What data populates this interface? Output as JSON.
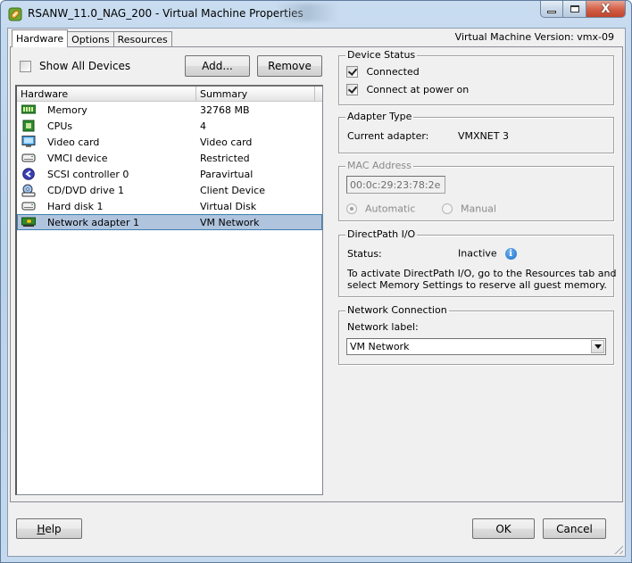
{
  "window": {
    "title": "RSANW_11.0_NAG_200 - Virtual Machine Properties",
    "app_icon": "vsphere-icon",
    "caption_buttons": {
      "minimize": "minimize-icon",
      "maximize": "maximize-icon",
      "close": "close-icon",
      "close_glyph": "X"
    }
  },
  "tabs": [
    {
      "label": "Hardware",
      "active": true
    },
    {
      "label": "Options",
      "active": false
    },
    {
      "label": "Resources",
      "active": false
    }
  ],
  "vm_version": "Virtual Machine Version: vmx-09",
  "hardware_panel": {
    "show_all_devices": {
      "label": "Show All Devices",
      "checked": false
    },
    "add_button": "Add...",
    "remove_button": "Remove",
    "table": {
      "columns": [
        "Hardware",
        "Summary"
      ],
      "rows": [
        {
          "icon": "memory-icon",
          "name": "Memory",
          "summary": "32768 MB",
          "selected": false
        },
        {
          "icon": "cpu-icon",
          "name": "CPUs",
          "summary": "4",
          "selected": false
        },
        {
          "icon": "monitor-icon",
          "name": "Video card",
          "summary": "Video card",
          "selected": false
        },
        {
          "icon": "device-icon",
          "name": "VMCI device",
          "summary": "Restricted",
          "selected": false
        },
        {
          "icon": "scsi-icon",
          "name": "SCSI controller 0",
          "summary": "Paravirtual",
          "selected": false
        },
        {
          "icon": "cd-dvd-icon",
          "name": "CD/DVD drive 1",
          "summary": "Client Device",
          "selected": false
        },
        {
          "icon": "hard-disk-icon",
          "name": "Hard disk 1",
          "summary": "Virtual Disk",
          "selected": false
        },
        {
          "icon": "network-adapter-icon",
          "name": "Network adapter 1",
          "summary": "VM Network",
          "selected": true
        }
      ]
    }
  },
  "device_status": {
    "title": "Device Status",
    "connected": {
      "label": "Connected",
      "checked": true
    },
    "connect_at_power_on": {
      "label": "Connect at power on",
      "checked": true
    }
  },
  "adapter_type": {
    "title": "Adapter Type",
    "label": "Current adapter:",
    "value": "VMXNET 3"
  },
  "mac_address": {
    "title": "MAC Address",
    "value": "00:0c:29:23:78:2e",
    "automatic_label": "Automatic",
    "manual_label": "Manual",
    "selected": "Automatic",
    "enabled": false
  },
  "directpath": {
    "title": "DirectPath I/O",
    "status_label": "Status:",
    "status_value": "Inactive",
    "info_glyph": "i",
    "message_line1": "To activate DirectPath I/O, go to the Resources tab and",
    "message_line2": "select Memory Settings to reserve all guest memory."
  },
  "network_connection": {
    "title": "Network Connection",
    "label": "Network label:",
    "selected": "VM Network"
  },
  "footer": {
    "help_prefix": "H",
    "help_rest": "elp",
    "ok": "OK",
    "cancel": "Cancel"
  },
  "colors": {
    "selection": "#b0c4de",
    "selection_border": "#3c7fb1",
    "dialog_bg": "#f0f0f0",
    "disabled_text": "#8a8a8a"
  }
}
